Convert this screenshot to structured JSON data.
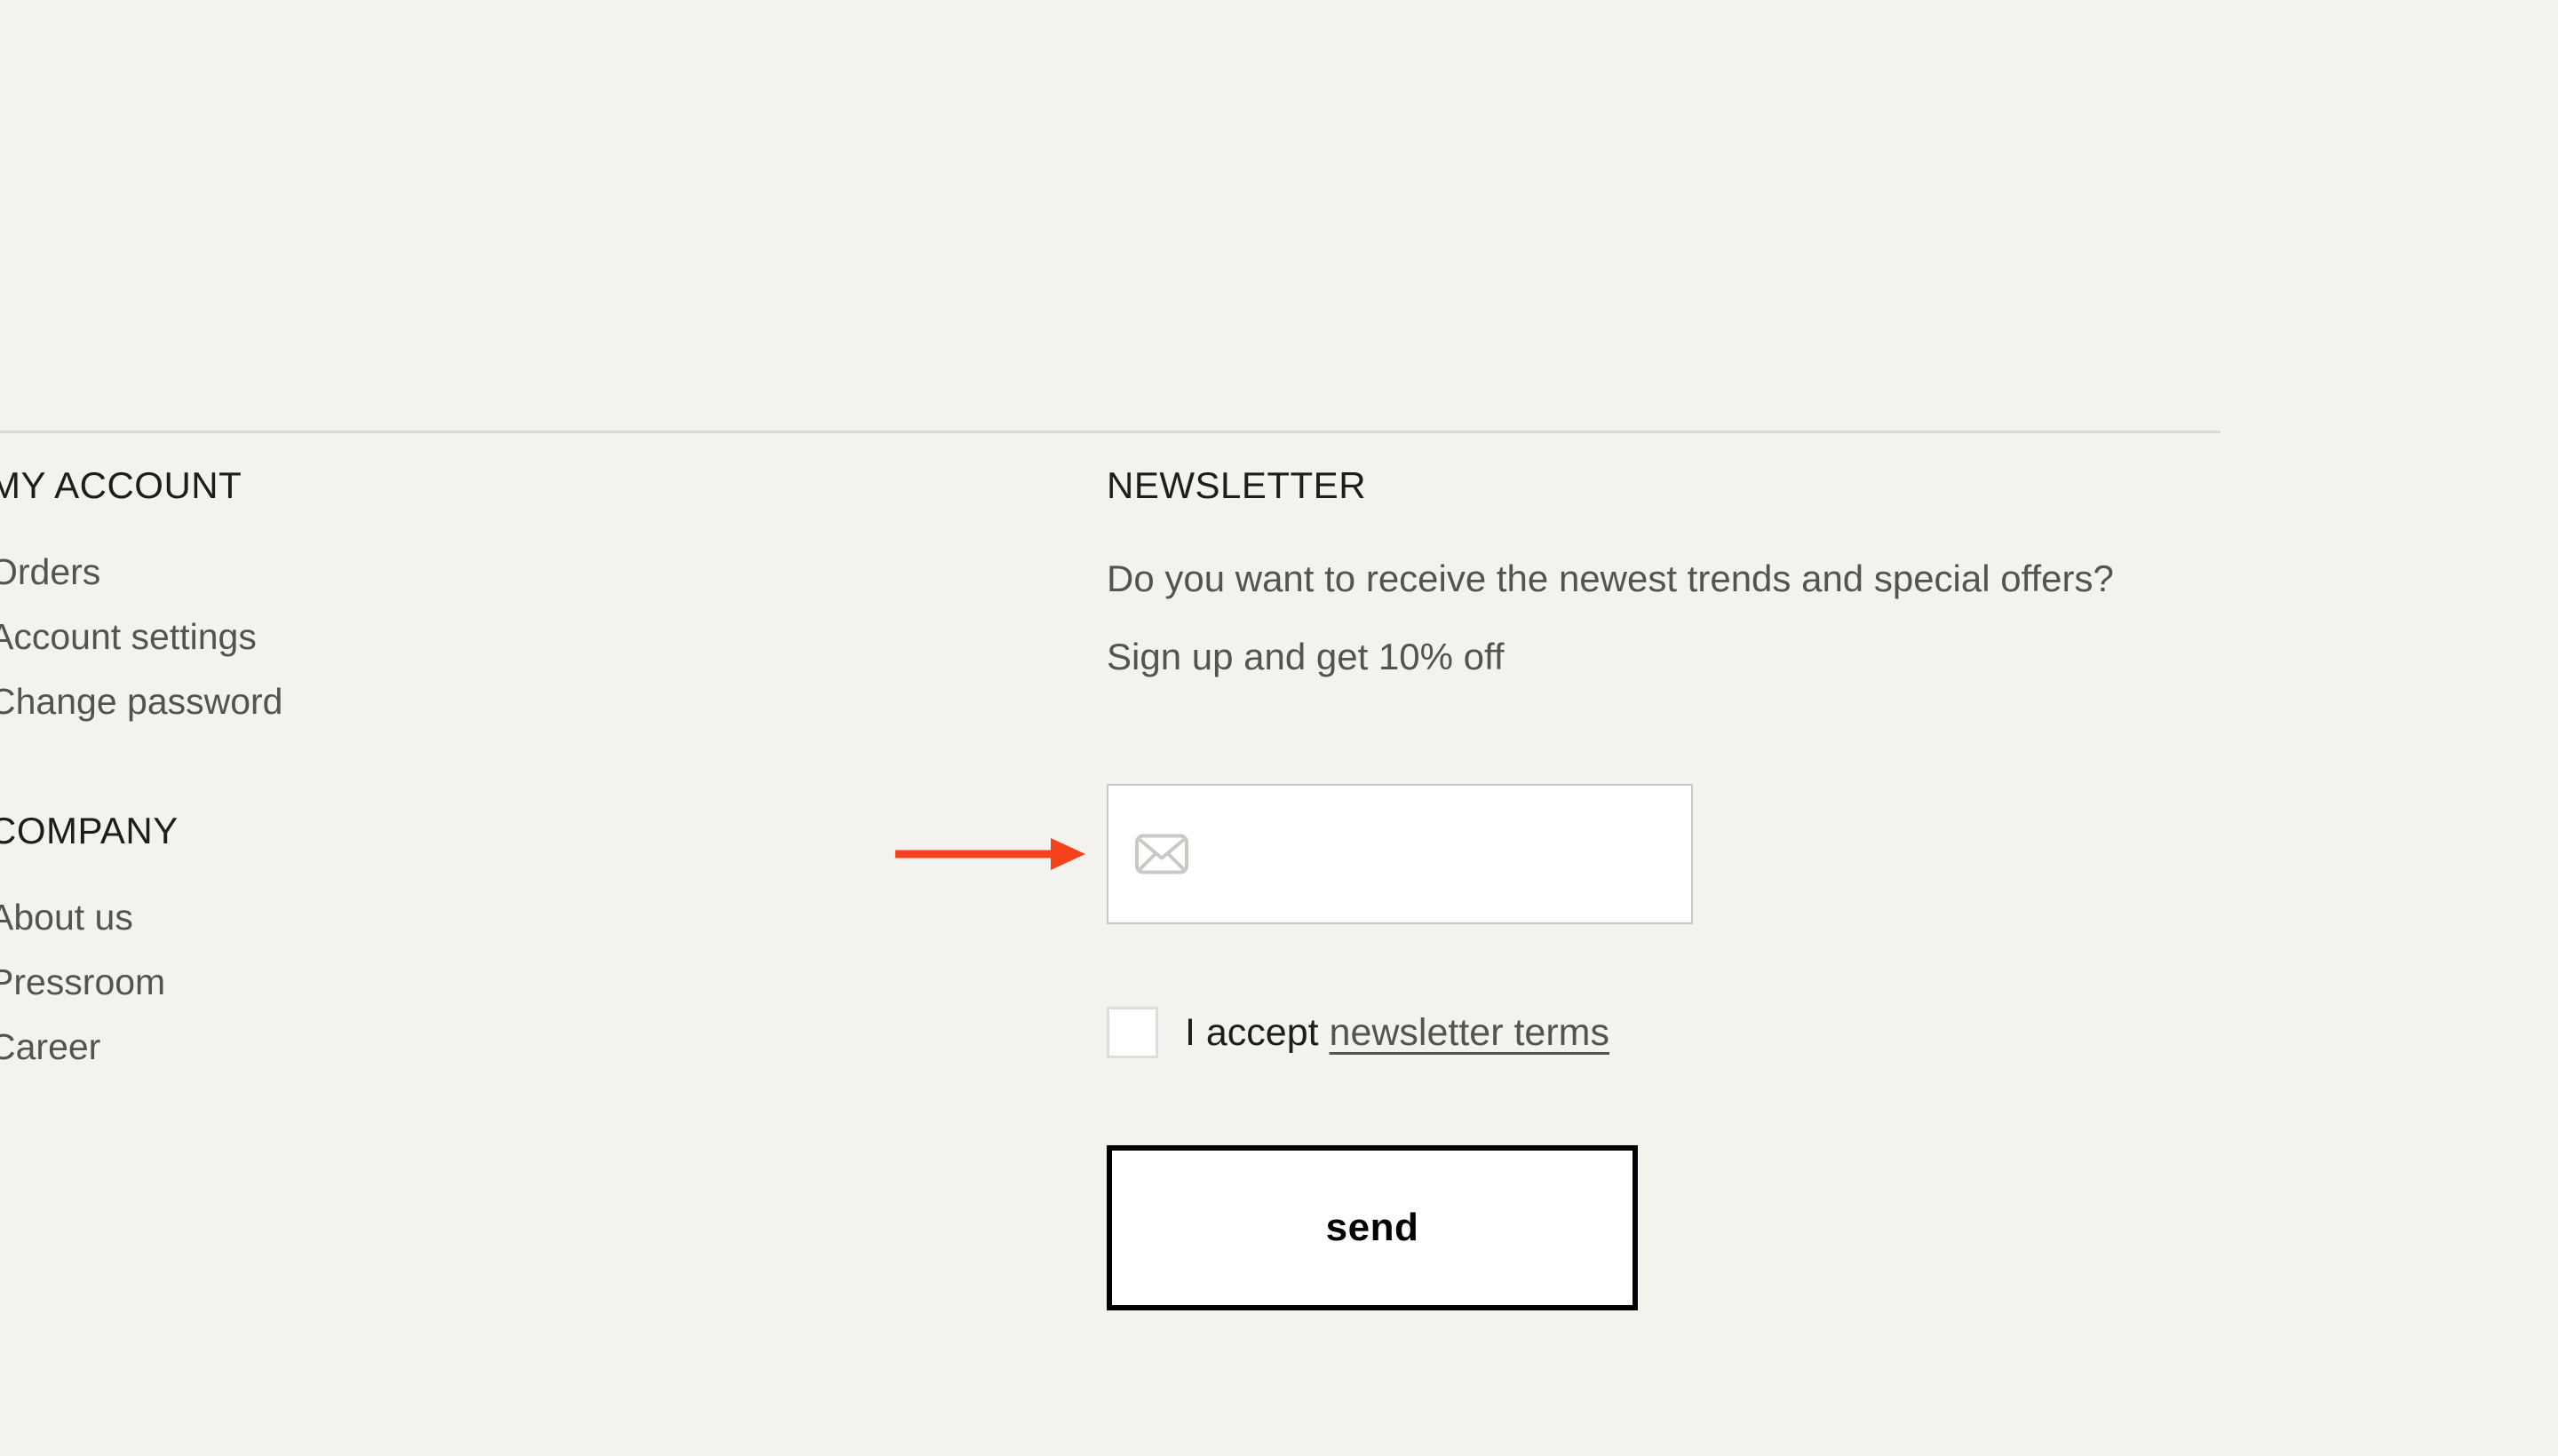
{
  "page": {
    "background_color": "#f3f2ee",
    "divider_color": "#dcdad5"
  },
  "footer": {
    "account_column": {
      "heading": "MY ACCOUNT",
      "links": [
        {
          "label": "Orders"
        },
        {
          "label": "Account settings"
        },
        {
          "label": "Change password"
        }
      ]
    },
    "company_column": {
      "heading": "COMPANY",
      "links": [
        {
          "label": "About us"
        },
        {
          "label": "Pressroom"
        },
        {
          "label": "Career"
        }
      ]
    },
    "newsletter": {
      "heading": "NEWSLETTER",
      "description": "Do you want to receive the newest trends and special offers? Sign up and get 10% off",
      "email_input": {
        "value": "",
        "placeholder": "",
        "icon": "envelope-icon",
        "border_color": "#c9c7c2",
        "background_color": "#ffffff"
      },
      "accept": {
        "checked": false,
        "prefix_label": "I accept",
        "terms_link_label": "newsletter terms"
      },
      "submit_button": {
        "label": "send",
        "border_color": "#000000",
        "background_color": "#ffffff",
        "text_color": "#000000"
      }
    }
  },
  "annotation": {
    "arrow": {
      "name": "pointer-arrow",
      "color": "#f4431c",
      "direction": "right",
      "points_to": "newsletter-email-input"
    }
  }
}
